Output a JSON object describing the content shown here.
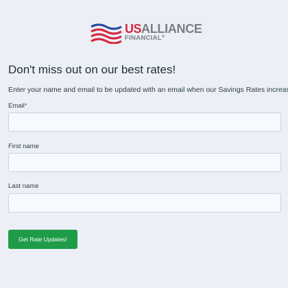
{
  "brand": {
    "us": "US",
    "alliance": "ALLIANCE",
    "financial": "FINANCIAL",
    "trademark": "®",
    "colors": {
      "red": "#d7263d",
      "blue": "#2a4b9b",
      "gray": "#7a7f86"
    }
  },
  "form": {
    "heading": "Don't miss out on our best rates!",
    "intro": "Enter your name and email to be updated with an email when our Savings Rates increase.",
    "fields": [
      {
        "label": "Email",
        "required_marker": "*",
        "value": ""
      },
      {
        "label": "First name",
        "value": ""
      },
      {
        "label": "Last name",
        "value": ""
      }
    ],
    "submit_label": "Get Rate Updates!"
  },
  "colors": {
    "background": "#ecf0f6",
    "button": "#1e9c48",
    "input_bg": "#f6f9fd",
    "input_border": "#cbd2dc"
  }
}
